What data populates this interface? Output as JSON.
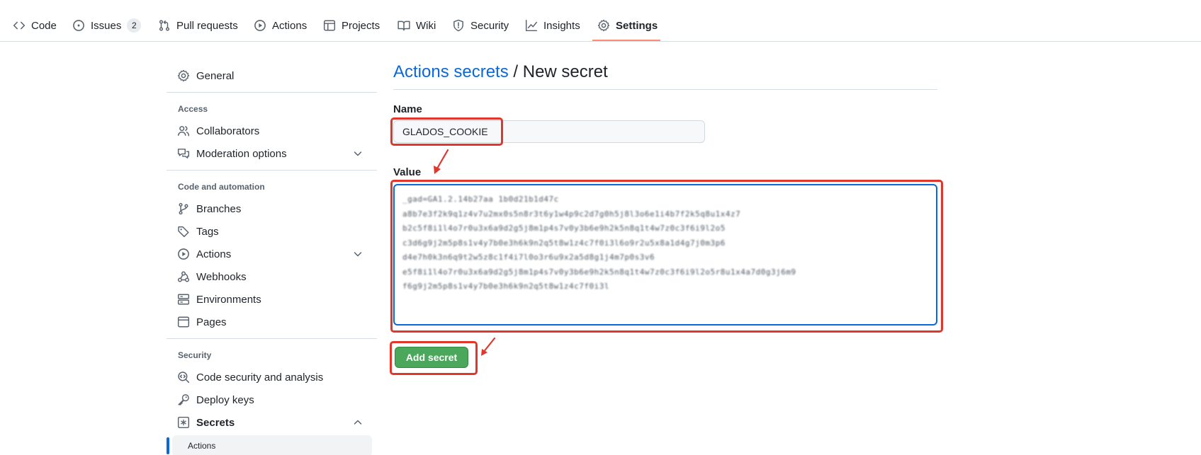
{
  "repo_nav": {
    "items": [
      {
        "label": "Code",
        "icon": "code-icon"
      },
      {
        "label": "Issues",
        "icon": "issue-icon",
        "count": "2"
      },
      {
        "label": "Pull requests",
        "icon": "pull-request-icon"
      },
      {
        "label": "Actions",
        "icon": "play-icon"
      },
      {
        "label": "Projects",
        "icon": "table-icon"
      },
      {
        "label": "Wiki",
        "icon": "book-icon"
      },
      {
        "label": "Security",
        "icon": "shield-icon"
      },
      {
        "label": "Insights",
        "icon": "graph-icon"
      },
      {
        "label": "Settings",
        "icon": "gear-icon",
        "selected": true
      }
    ]
  },
  "sidebar": {
    "general": "General",
    "sections": [
      {
        "heading": "Access",
        "items": [
          "Collaborators",
          "Moderation options"
        ]
      },
      {
        "heading": "Code and automation",
        "items": [
          "Branches",
          "Tags",
          "Actions",
          "Webhooks",
          "Environments",
          "Pages"
        ]
      },
      {
        "heading": "Security",
        "items": [
          "Code security and analysis",
          "Deploy keys",
          "Secrets"
        ]
      }
    ],
    "secrets_sub_item": "Actions"
  },
  "main": {
    "breadcrumb_link": "Actions secrets",
    "breadcrumb_separator": " / ",
    "breadcrumb_current": "New secret",
    "name_label": "Name",
    "name_value": "GLADOS_COOKIE",
    "value_label": "Value",
    "value_lines": [
      "_gad=GA1.2.14b27aa 1b0d21b1d47c",
      "a8b7e3f2k9q1z4v7u2mx0s5n8r3t6y1w4p9c2d7g0h5j8l3o6e1i4b7f2k5q8u1x4z7",
      "b2c5f8i1l4o7r0u3x6a9d2g5j8m1p4s7v0y3b6e9h2k5n8q1t4w7z0c3f6i9l2o5",
      "c3d6g9j2m5p8s1v4y7b0e3h6k9n2q5t8w1z4c7f0i3l6o9r2u5x8a1d4g7j0m3p6",
      "d4e7h0k3n6q9t2w5z8c1f4i7l0o3r6u9x2a5d8g1j4m7p0s3v6",
      "e5f8i1l4o7r0u3x6a9d2g5j8m1p4s7v0y3b6e9h2k5n8q1t4w7z0c3f6i9l2o5r8u1x4a7d0g3j6m9",
      "f6g9j2m5p8s1v4y7b0e3h6k9n2q5t8w1z4c7f0i3l"
    ],
    "add_button": "Add secret"
  }
}
